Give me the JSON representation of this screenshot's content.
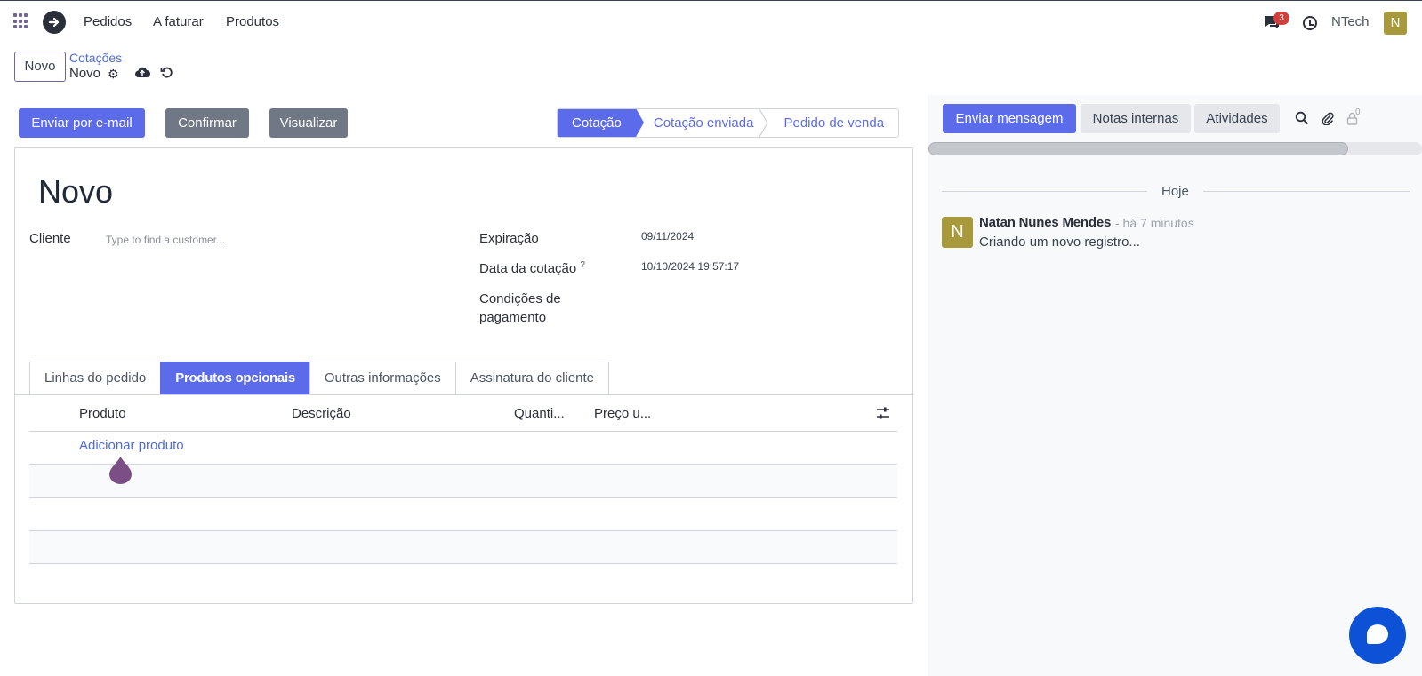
{
  "navbar": {
    "menu_items": [
      "Pedidos",
      "A faturar",
      "Produtos"
    ],
    "chat_badge": "3",
    "company": "NTech",
    "user_initial": "N"
  },
  "control_panel": {
    "new_label": "Novo",
    "breadcrumb": "Cotações",
    "record_name": "Novo"
  },
  "actions": {
    "send_email": "Enviar por e-mail",
    "confirm": "Confirmar",
    "preview": "Visualizar"
  },
  "statusbar": {
    "stages": [
      "Cotação",
      "Cotação enviada",
      "Pedido de venda"
    ],
    "active_index": 0
  },
  "form": {
    "title": "Novo",
    "customer_label": "Cliente",
    "customer_placeholder": "Type to find a customer...",
    "expiration_label": "Expiração",
    "expiration_value": "09/11/2024",
    "quote_date_label": "Data da cotação",
    "quote_date_help": "?",
    "quote_date_value": "10/10/2024 19:57:17",
    "payment_terms_label_1": "Condições de",
    "payment_terms_label_2": "pagamento"
  },
  "tabs": [
    "Linhas do pedido",
    "Produtos opcionais",
    "Outras informações",
    "Assinatura do cliente"
  ],
  "active_tab": 1,
  "table": {
    "columns": [
      "Produto",
      "Descrição",
      "Quanti...",
      "Preço u..."
    ],
    "add_label": "Adicionar produto"
  },
  "chatter": {
    "send_message": "Enviar mensagem",
    "internal_notes": "Notas internas",
    "activities": "Atividades",
    "followers_count": "0",
    "date_separator": "Hoje",
    "message": {
      "avatar_initial": "N",
      "author": "Natan Nunes Mendes",
      "time": "- há 7 minutos",
      "body": "Criando um novo registro..."
    }
  },
  "colors": {
    "primary": "#5b6bea",
    "secondary": "#707785",
    "brand": "#71639e",
    "avatar": "#a89a3c",
    "badge": "#d23f3a",
    "fab": "#0d52d6"
  }
}
